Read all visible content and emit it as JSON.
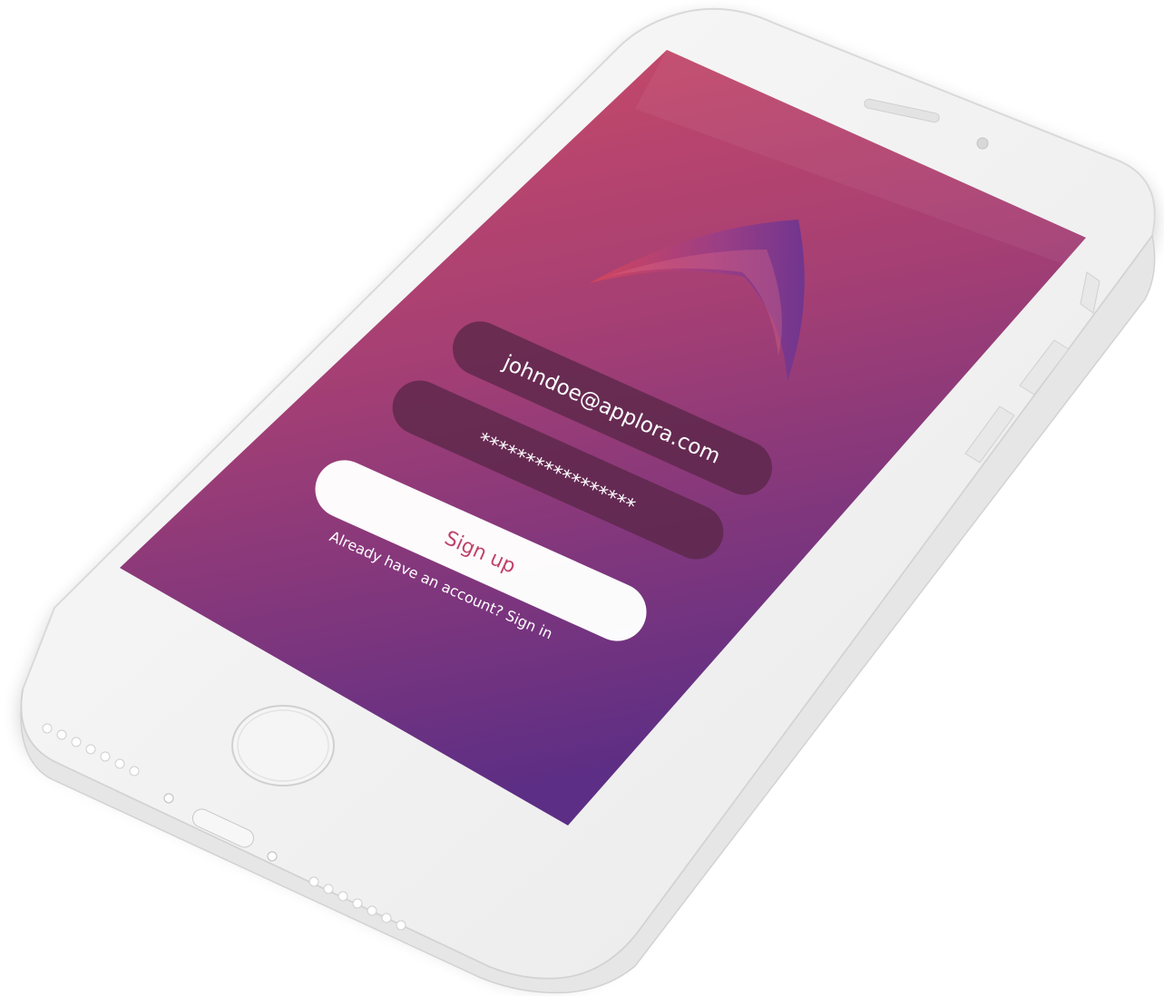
{
  "device": {
    "name": "smartphone",
    "body_color": "#f3f3f3"
  },
  "screen": {
    "gradient_top": "#cd4b66",
    "gradient_bottom": "#5c2e85"
  },
  "logo": {
    "icon": "arrow-chevron-logo-icon"
  },
  "form": {
    "email_value": "johndoe@applora.com",
    "password_value": "*****************",
    "field_color": "#5a2748",
    "signup_label": "Sign up",
    "signup_bg": "#ffffff",
    "signin_prompt": "Already have an account? Sign in"
  }
}
